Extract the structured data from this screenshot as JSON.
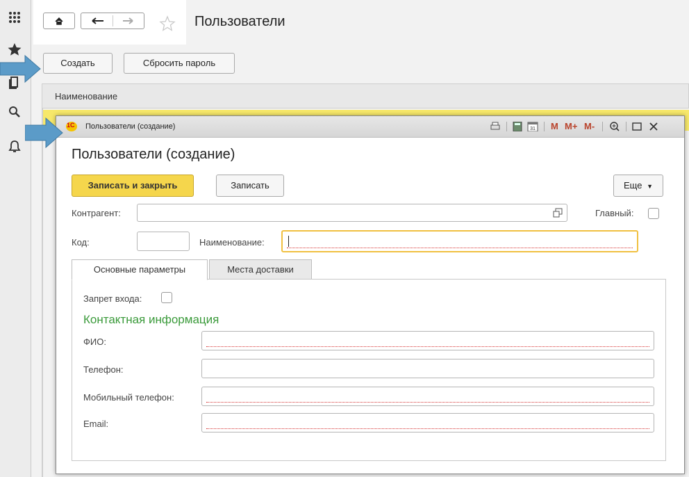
{
  "app": {
    "page_title": "Пользователи",
    "toolbar": {
      "create_label": "Создать",
      "reset_password_label": "Сбросить пароль"
    },
    "list": {
      "column_name": "Наименование"
    }
  },
  "dialog": {
    "window_title": "Пользователи (создание)",
    "heading": "Пользователи (создание)",
    "toolbar_icons": [
      "print-icon",
      "calculator-icon",
      "calendar-icon"
    ],
    "memory_buttons": [
      "M",
      "M+",
      "M-"
    ],
    "buttons": {
      "save_close": "Записать и закрыть",
      "save": "Записать",
      "more": "Еще"
    },
    "fields": {
      "counterparty_label": "Контрагент:",
      "main_label": "Главный:",
      "code_label": "Код:",
      "name_label": "Наименование:"
    },
    "tabs": [
      {
        "label": "Основные параметры"
      },
      {
        "label": "Места доставки"
      }
    ],
    "main_tab": {
      "login_ban_label": "Запрет входа:",
      "contact_section": "Контактная информация",
      "fio_label": "ФИО:",
      "phone_label": "Телефон:",
      "mobile_label": "Мобильный телефон:",
      "email_label": "Email:"
    }
  },
  "colors": {
    "accent_yellow": "#f7d74a",
    "highlight_row": "#f7e86a",
    "section_green": "#3a9a3a",
    "arrow_blue": "#5b9bc8"
  }
}
